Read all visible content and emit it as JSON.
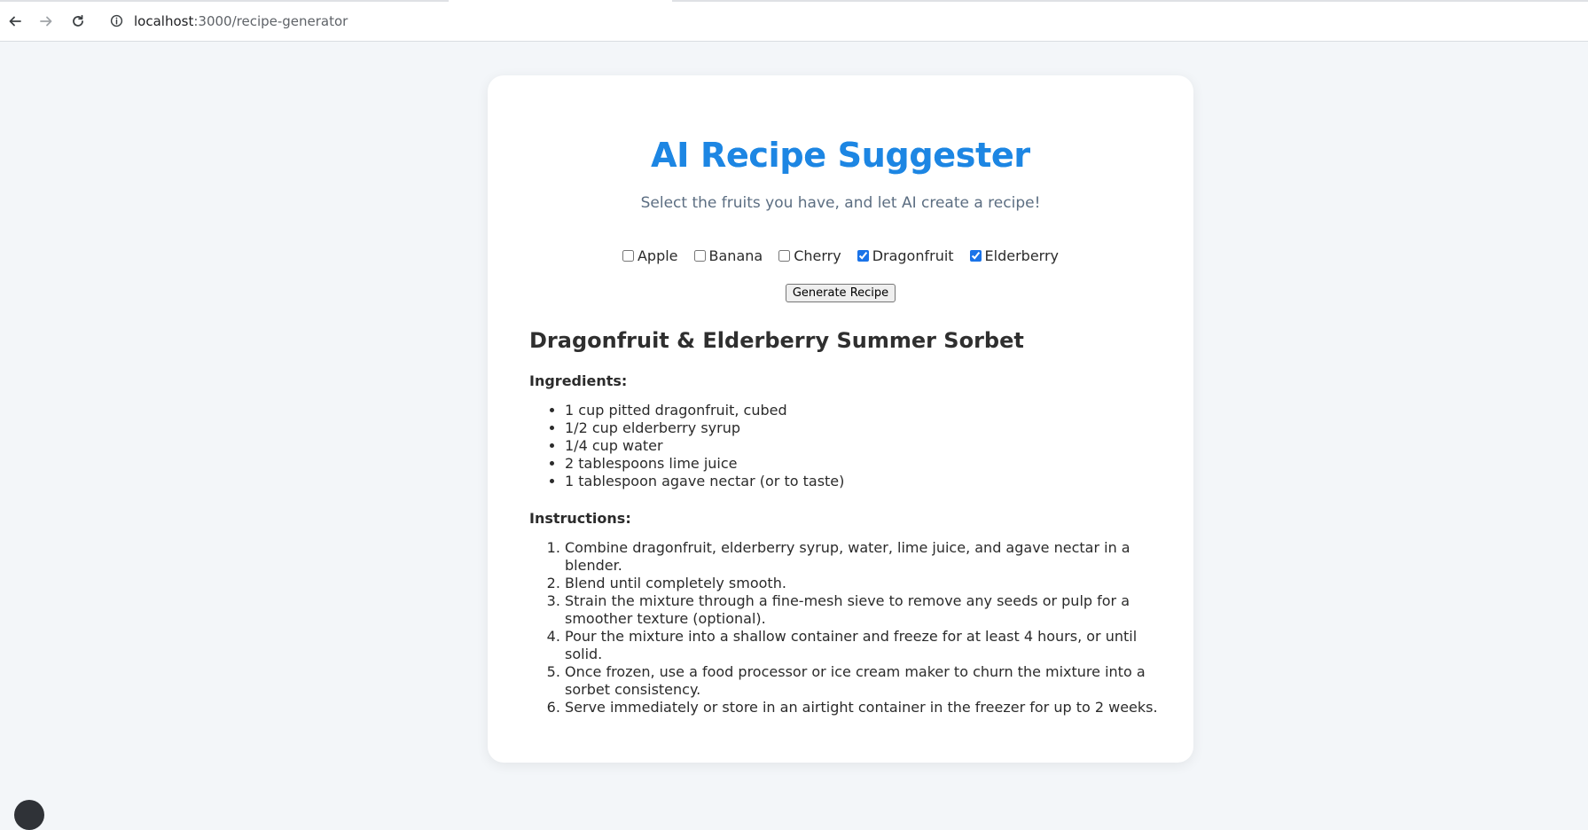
{
  "browser": {
    "url_host": "localhost",
    "url_path": ":3000/recipe-generator"
  },
  "app": {
    "title": "AI Recipe Suggester",
    "subtitle": "Select the fruits you have, and let AI create a recipe!",
    "fruits": [
      {
        "label": "Apple",
        "checked": false
      },
      {
        "label": "Banana",
        "checked": false
      },
      {
        "label": "Cherry",
        "checked": false
      },
      {
        "label": "Dragonfruit",
        "checked": true
      },
      {
        "label": "Elderberry",
        "checked": true
      }
    ],
    "generate_label": "Generate Recipe",
    "title_color": "#1d86e3"
  },
  "recipe": {
    "title": "Dragonfruit & Elderberry Summer Sorbet",
    "ingredients_heading": "Ingredients:",
    "ingredients": [
      "1 cup pitted dragonfruit, cubed",
      "1/2 cup elderberry syrup",
      "1/4 cup water",
      "2 tablespoons lime juice",
      "1 tablespoon agave nectar (or to taste)"
    ],
    "instructions_heading": "Instructions:",
    "instructions": [
      "Combine dragonfruit, elderberry syrup, water, lime juice, and agave nectar in a blender.",
      "Blend until completely smooth.",
      "Strain the mixture through a fine-mesh sieve to remove any seeds or pulp for a smoother texture (optional).",
      "Pour the mixture into a shallow container and freeze for at least 4 hours, or until solid.",
      "Once frozen, use a food processor or ice cream maker to churn the mixture into a sorbet consistency.",
      "Serve immediately or store in an airtight container in the freezer for up to 2 weeks."
    ]
  }
}
